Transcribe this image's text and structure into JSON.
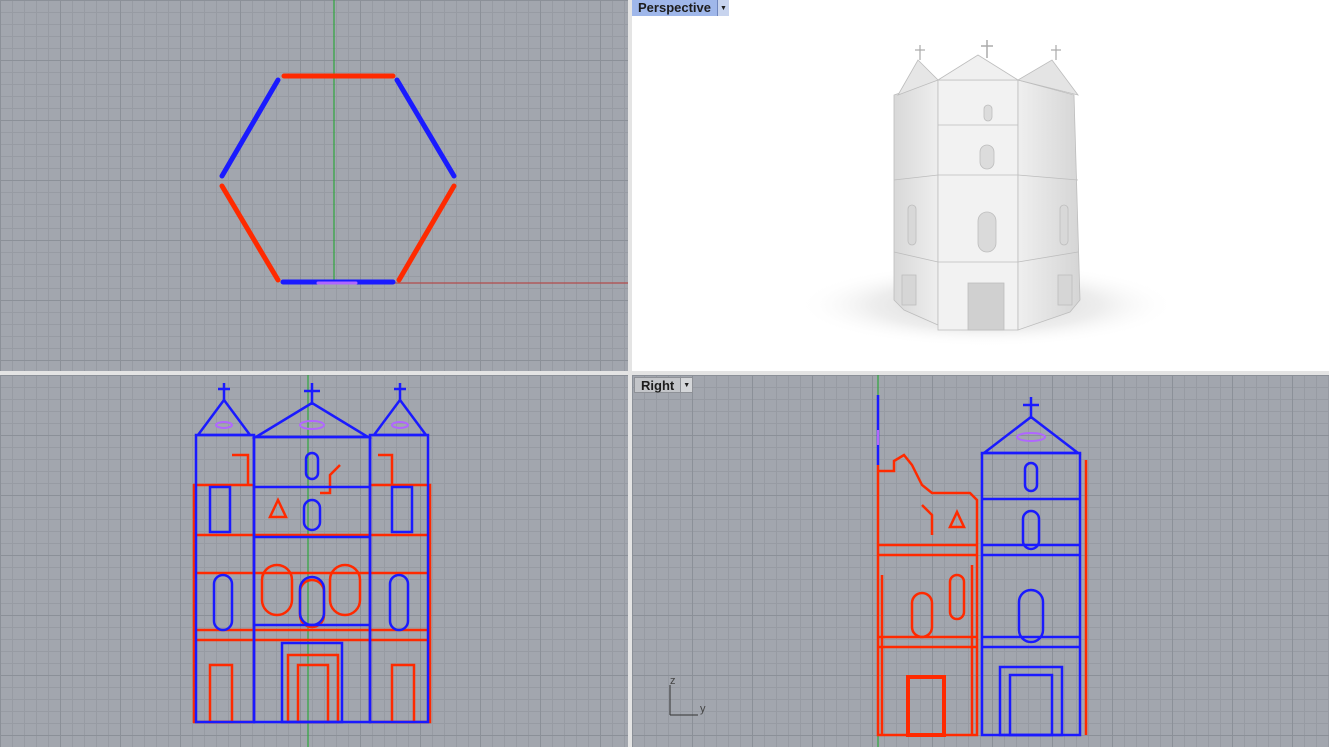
{
  "viewports": {
    "top": {
      "label": ""
    },
    "perspective": {
      "label": "Perspective",
      "active": true
    },
    "front": {
      "label": ""
    },
    "right": {
      "label": "Right",
      "active": false
    }
  },
  "axis_widget": {
    "vertical": "z",
    "horizontal": "y"
  },
  "colors": {
    "grid_bg": "#a2a6ae",
    "major_grid": "#8b9098",
    "minor_grid": "#979ba3",
    "x_axis": "#b34b4b",
    "y_axis": "#2ea63d",
    "selection_red": "#ff2a00",
    "selection_blue": "#1a1aff",
    "highlight_magenta": "#b066ff",
    "render_bg": "#ffffff"
  },
  "icons": {
    "viewport_menu": "chevron-down-icon"
  }
}
